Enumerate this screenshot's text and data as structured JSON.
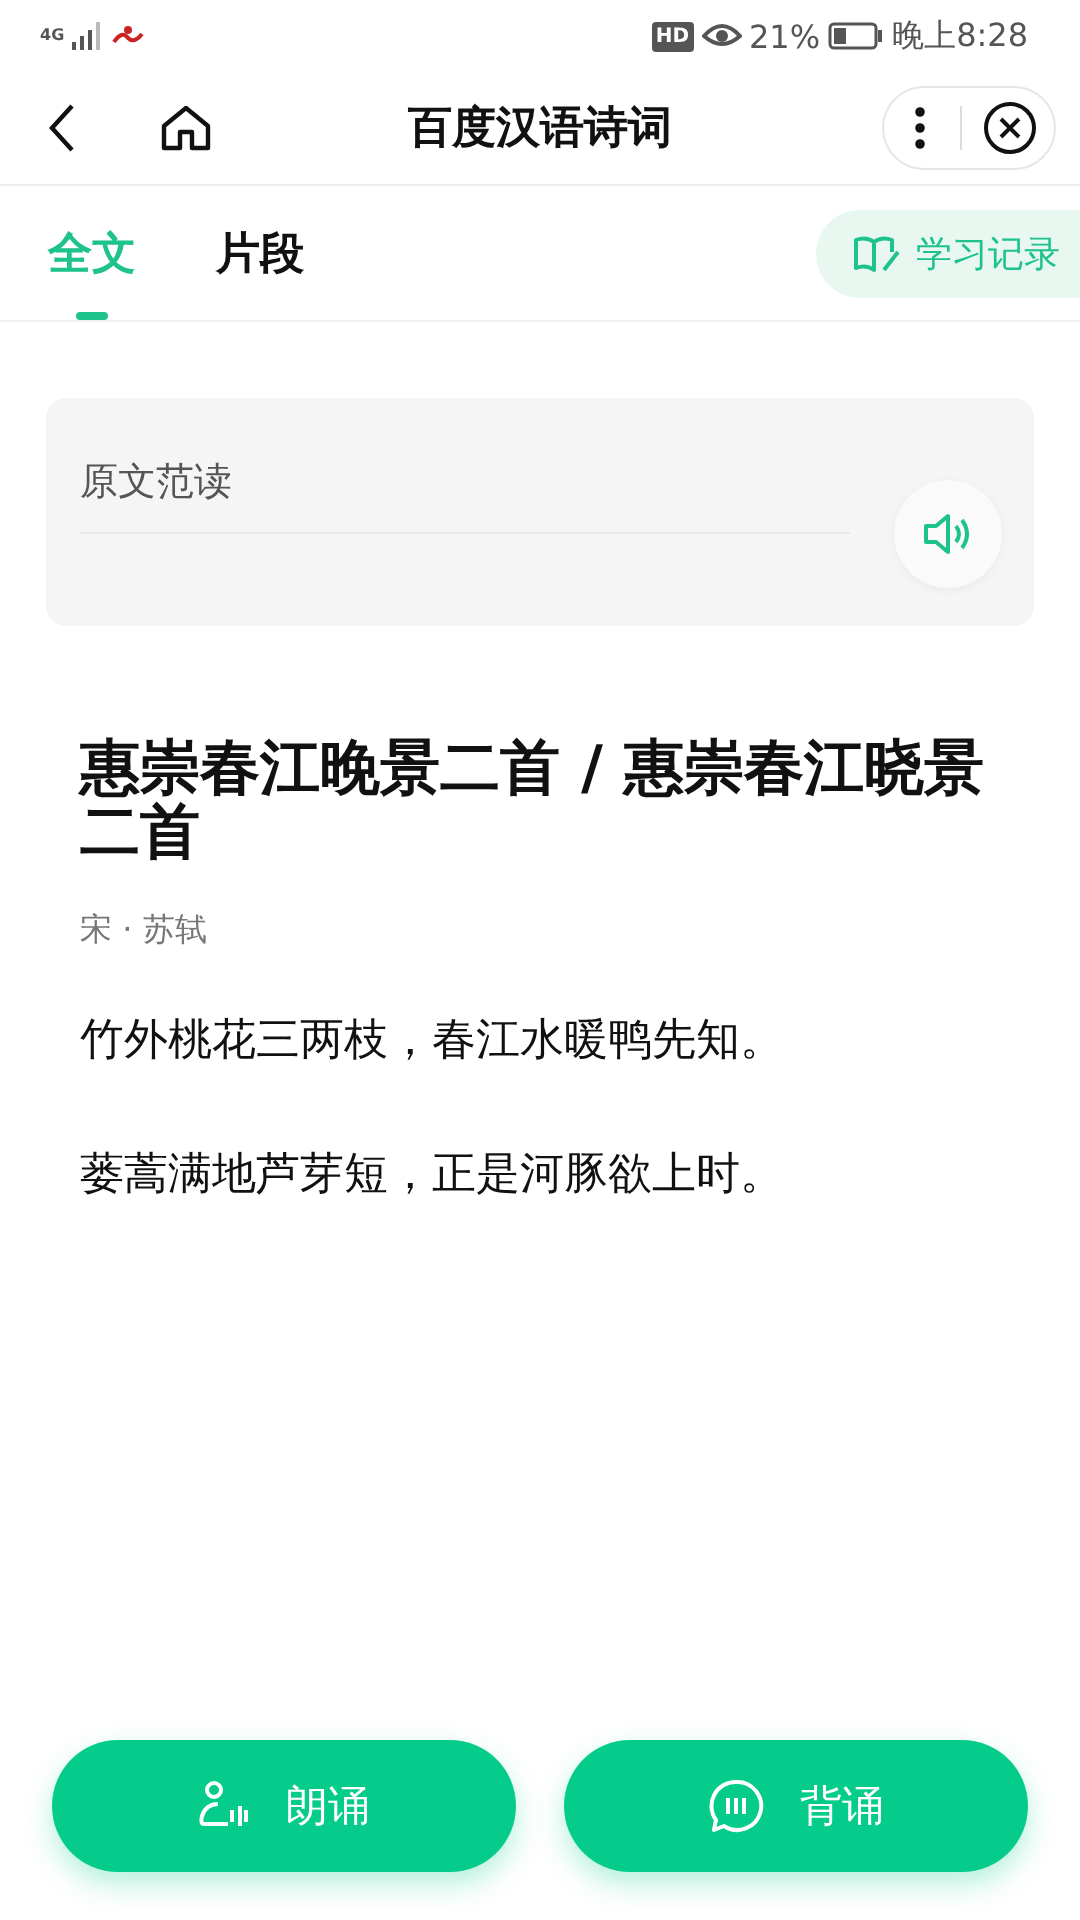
{
  "status_bar": {
    "network": "4G",
    "hd": "HD",
    "battery": "21%",
    "time": "晚上8:28"
  },
  "header": {
    "title": "百度汉语诗词"
  },
  "tabs": [
    {
      "label": "全文",
      "selected": true
    },
    {
      "label": "片段",
      "selected": false
    }
  ],
  "history_button": {
    "label": "学习记录"
  },
  "audio_card": {
    "title": "原文范读"
  },
  "poem": {
    "title": "惠崇春江晚景二首 / 惠崇春江晓景二首",
    "author": "宋 · 苏轼",
    "lines": [
      "竹外桃花三两枝，春江水暖鸭先知。",
      "蒌蒿满地芦芽短，正是河豚欲上时。"
    ]
  },
  "actions": [
    {
      "kind": "recite",
      "label": "朗诵"
    },
    {
      "kind": "memorize",
      "label": "背诵"
    }
  ]
}
